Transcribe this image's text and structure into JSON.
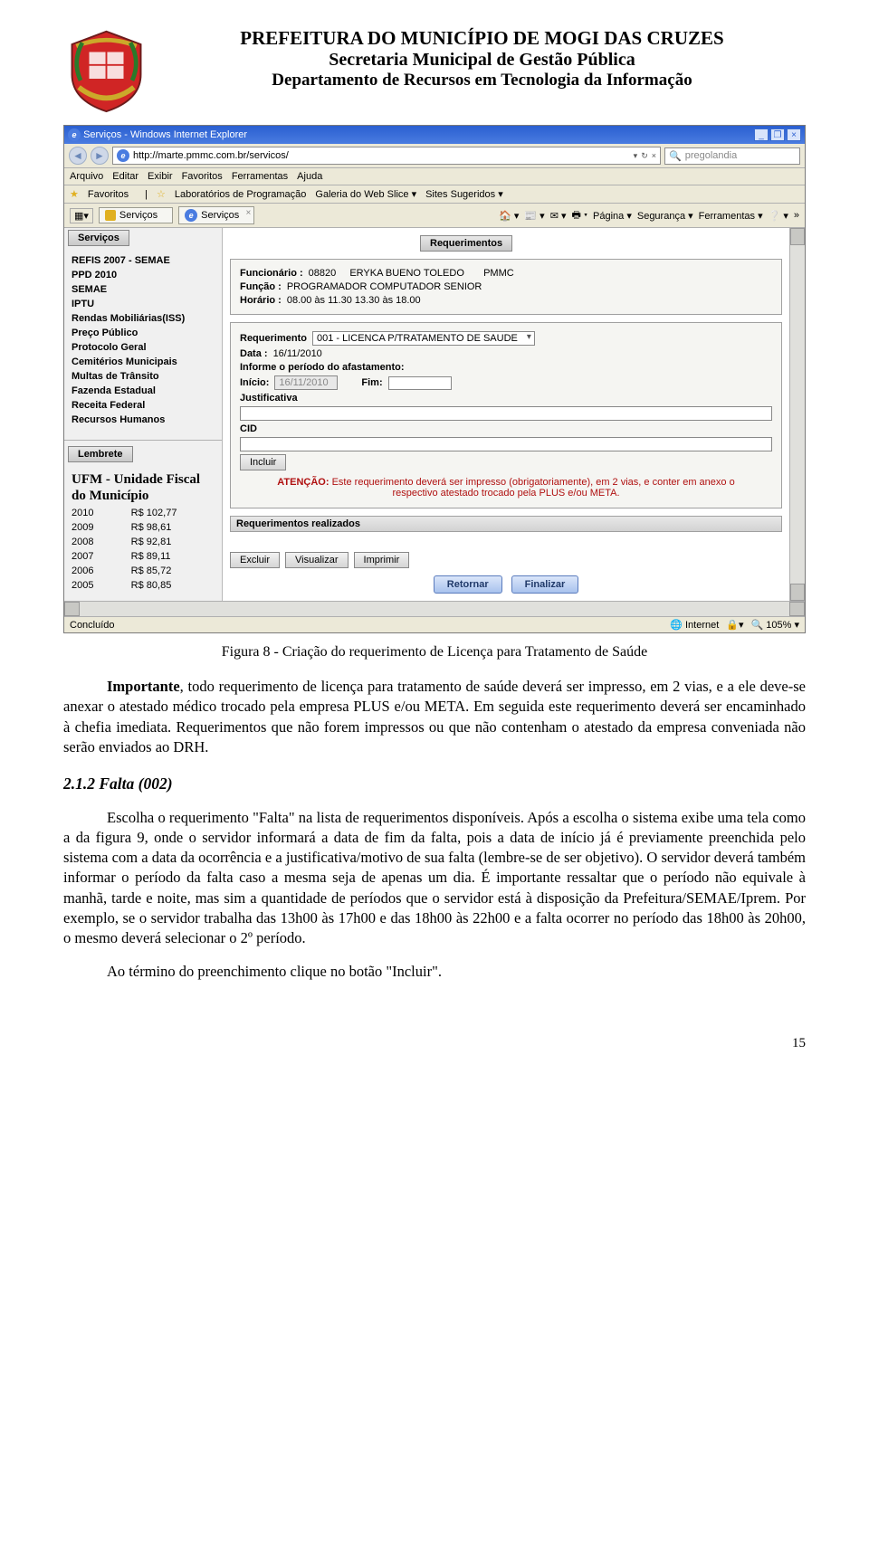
{
  "letterhead": {
    "line1": "PREFEITURA DO MUNICÍPIO DE MOGI DAS CRUZES",
    "line2": "Secretaria Municipal de Gestão Pública",
    "line3": "Departamento de Recursos em Tecnologia da Informação"
  },
  "screenshot": {
    "titlebar": "Serviços - Windows Internet Explorer",
    "win_min": "_",
    "win_max": "❐",
    "win_close": "×",
    "nav_back": "◄",
    "nav_fwd": "►",
    "url": "http://marte.pmmc.com.br/servicos/",
    "url_dd": "▾",
    "url_refresh": "↻",
    "url_stop": "×",
    "search_placeholder": "pregolandia",
    "search_icon": "🔍",
    "menubar": [
      "Arquivo",
      "Editar",
      "Exibir",
      "Favoritos",
      "Ferramentas",
      "Ajuda"
    ],
    "favbar": {
      "label": "Favoritos",
      "items": [
        "Laboratórios de Programação",
        "Galeria do Web Slice ▾",
        "Sites Sugeridos ▾"
      ]
    },
    "tabs": {
      "left": "Serviços",
      "right": "Serviços"
    },
    "cmdbar": {
      "icons": [
        "🏠 ▾",
        "📰 ▾",
        "✉ ▾",
        "🖶 ▾"
      ],
      "items": [
        "Página ▾",
        "Segurança ▾",
        "Ferramentas ▾",
        "❔ ▾"
      ],
      "more": "»"
    },
    "sidebar": {
      "tab": "Serviços",
      "links": [
        "REFIS 2007 - SEMAE",
        "PPD 2010",
        "SEMAE",
        "IPTU",
        "Rendas Mobiliárias(ISS)",
        "Preço Público",
        "Protocolo Geral",
        "Cemitérios Municipais",
        "Multas de Trânsito",
        "Fazenda Estadual",
        "Receita Federal",
        "Recursos Humanos"
      ],
      "lembrete_tab": "Lembrete",
      "ufm_title": "UFM - Unidade Fiscal do Município",
      "ufm_rows": [
        {
          "y": "2010",
          "v": "R$ 102,77"
        },
        {
          "y": "2009",
          "v": "R$ 98,61"
        },
        {
          "y": "2008",
          "v": "R$ 92,81"
        },
        {
          "y": "2007",
          "v": "R$ 89,11"
        },
        {
          "y": "2006",
          "v": "R$ 85,72"
        },
        {
          "y": "2005",
          "v": "R$ 80,85"
        }
      ]
    },
    "form": {
      "title_tab": "Requerimentos",
      "funcionario_label": "Funcionário :",
      "funcionario_matricula": "08820",
      "funcionario_nome": "ERYKA BUENO TOLEDO",
      "funcionario_org": "PMMC",
      "funcao_label": "Função :",
      "funcao_value": "PROGRAMADOR COMPUTADOR SENIOR",
      "horario_label": "Horário :",
      "horario_value": "08.00 às 11.30    13.30 às 18.00",
      "requerimento_label": "Requerimento",
      "requerimento_value": "001 - LICENCA P/TRATAMENTO DE SAUDE",
      "data_label": "Data :",
      "data_value": "16/11/2010",
      "periodo_label": "Informe o período do afastamento:",
      "inicio_label": "Início:",
      "inicio_value": "16/11/2010",
      "fim_label": "Fim:",
      "fim_value": "",
      "justificativa_label": "Justificativa",
      "cid_label": "CID",
      "incluir": "Incluir",
      "atencao_label": "ATENÇÃO:",
      "atencao_text": "Este requerimento deverá ser impresso (obrigatoriamente), em 2 vias, e conter em anexo o respectivo atestado trocado pela PLUS e/ou META.",
      "realizados": "Requerimentos realizados",
      "excluir": "Excluir",
      "visualizar": "Visualizar",
      "imprimir": "Imprimir",
      "retornar": "Retornar",
      "finalizar": "Finalizar"
    },
    "statusbar": {
      "left": "Concluído",
      "internet": "Internet",
      "protected": "🔒▾",
      "zoom": "🔍 105% ▾"
    }
  },
  "caption": "Figura 8 - Criação do requerimento de Licença para Tratamento de Saúde",
  "para1_strong": "Importante",
  "para1": ", todo requerimento de licença para tratamento de saúde deverá ser impresso, em 2 vias, e a ele deve-se anexar o atestado médico trocado pela empresa PLUS e/ou META. Em seguida este requerimento deverá ser encaminhado à chefia imediata. Requerimentos que não forem impressos ou que não contenham o atestado da empresa conveniada não serão enviados ao DRH.",
  "section_title": "2.1.2 Falta (002)",
  "para2": "Escolha o requerimento \"Falta\" na lista de requerimentos disponíveis. Após a escolha o sistema exibe uma tela como a da figura 9, onde o servidor informará a data de fim da falta, pois a data de início já é previamente preenchida pelo sistema com a data da ocorrência e a justificativa/motivo de sua falta (lembre-se de ser objetivo). O servidor deverá também informar o período da falta caso a mesma seja de apenas um dia. É importante ressaltar que o período não equivale à manhã, tarde e noite, mas sim a quantidade de períodos que o servidor está à disposição da Prefeitura/SEMAE/Iprem. Por exemplo, se o servidor trabalha das 13h00 às 17h00 e das 18h00 às 22h00 e a falta ocorrer no período das 18h00 às 20h00, o mesmo deverá selecionar o 2º período.",
  "para3": "Ao término do preenchimento clique no botão \"Incluir\".",
  "page_number": "15"
}
